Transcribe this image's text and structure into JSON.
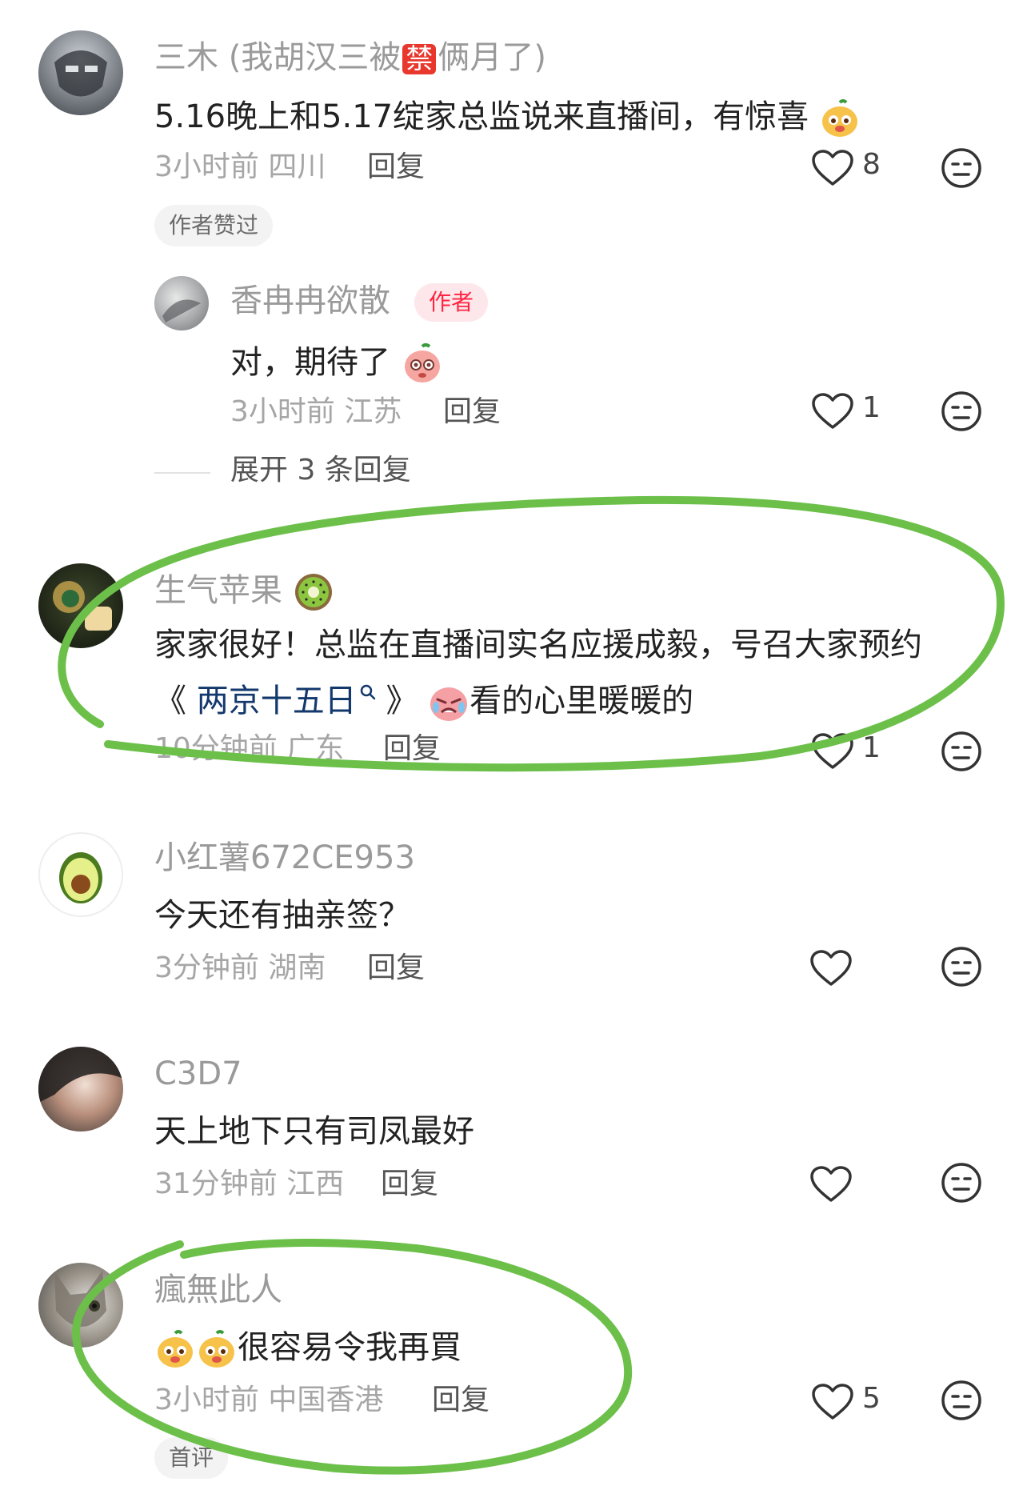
{
  "comments": [
    {
      "name": "三木 (我胡汉三被",
      "name_ban_char": "禁",
      "name_tail": "俩月了)",
      "text": "5.16晚上和5.17绽家总监说来直播间，有惊喜",
      "time_loc": "3小时前 四川",
      "reply_label": "回复",
      "likes": "8",
      "badge": "作者赞过",
      "sub_reply": {
        "name": "香冉冉欲散",
        "tag": "作者",
        "text": "对，期待了",
        "time_loc": "3小时前 江苏",
        "reply_label": "回复",
        "likes": "1"
      },
      "expand": "展开 3 条回复"
    },
    {
      "name": "生气苹果",
      "text_line1": "家家很好！总监在直播间实名应援成毅，号召大家预约",
      "text_link_open": "《",
      "text_link": "两京十五日",
      "text_link_close": "》",
      "text_line2_tail": "看的心里暖暖的",
      "time_loc": "10分钟前 广东",
      "reply_label": "回复",
      "likes": "1"
    },
    {
      "name": "小红薯672CE953",
      "text": "今天还有抽亲签？",
      "time_loc": "3分钟前 湖南",
      "reply_label": "回复"
    },
    {
      "name": "C3D7",
      "text": "天上地下只有司凤最好",
      "time_loc": "31分钟前 江西",
      "reply_label": "回复"
    },
    {
      "name": "瘋無此人",
      "text": "很容易令我再買",
      "time_loc": "3小时前 中国香港",
      "reply_label": "回复",
      "likes": "5",
      "badge": "首评"
    }
  ],
  "colors": {
    "accent_red": "#ff2442",
    "annotation_green": "#6cc04a",
    "meta_gray": "#a6a6a6"
  }
}
